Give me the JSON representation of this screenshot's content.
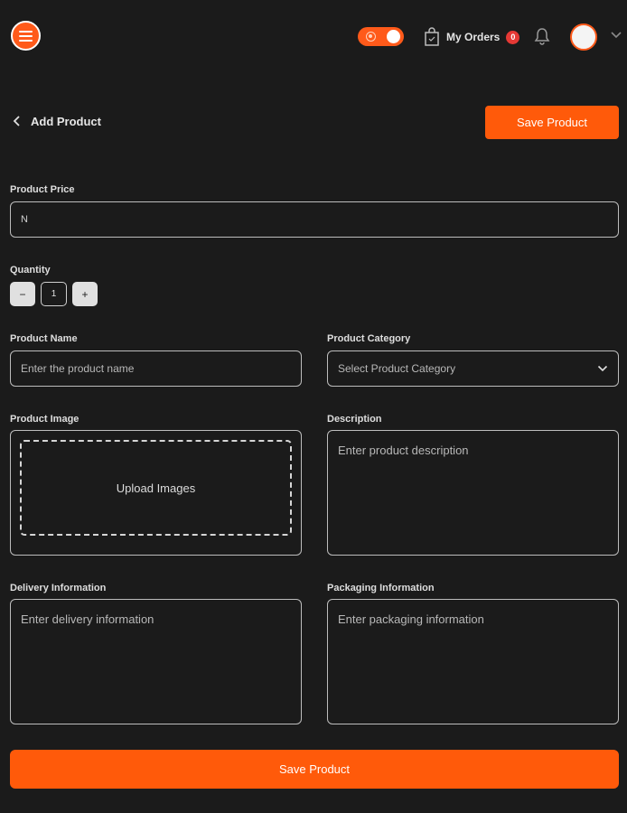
{
  "header": {
    "orders_label": "My Orders",
    "orders_count": "0"
  },
  "page": {
    "title": "Add Product",
    "save_label": "Save Product"
  },
  "form": {
    "price_label": "Product Price",
    "price_value": "N",
    "quantity_label": "Quantity",
    "quantity_decrement": "−",
    "quantity_value": "1",
    "quantity_increment": "+",
    "name_label": "Product Name",
    "name_placeholder": "Enter the product name",
    "category_label": "Product Category",
    "category_placeholder": "Select Product Category",
    "image_label": "Product Image",
    "upload_label": "Upload Images",
    "description_label": "Description",
    "description_placeholder": "Enter product description",
    "delivery_label": "Delivery Information",
    "delivery_placeholder": "Enter delivery information",
    "packaging_label": "Packaging Information",
    "packaging_placeholder": "Enter packaging information"
  },
  "colors": {
    "accent": "#ff5a0a",
    "background": "#1b1b1b",
    "badge": "#e53935"
  },
  "icons": [
    "menu-icon",
    "sun-icon",
    "shopping-bag-icon",
    "bell-icon",
    "avatar",
    "chevron-down-icon",
    "back-arrow-icon"
  ]
}
